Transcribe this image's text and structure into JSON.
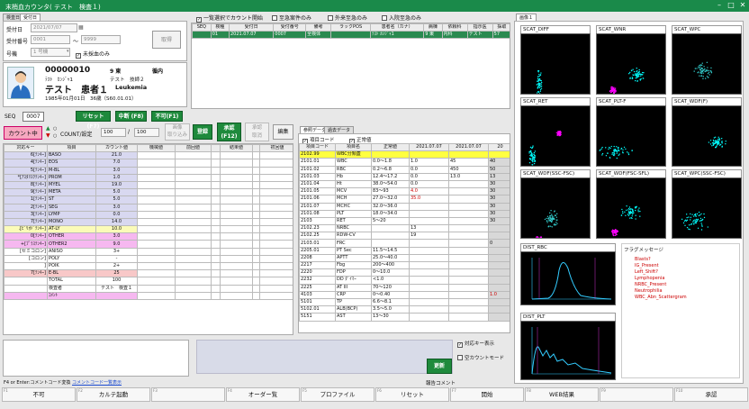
{
  "app": {
    "title": "末梢血カウンタ( テスト　検査１)"
  },
  "tabs_left": [
    "検査日",
    "受付日"
  ],
  "form": {
    "uketsuke_label": "受付日",
    "uketsuke_value": "2021/07/07",
    "bango_label": "受付番号",
    "bango_from": "0001",
    "bango_sep": "～",
    "bango_to": "9999",
    "gouki_label": "号機",
    "gouki_value": "1 号機",
    "mikettei": "未採血のみ",
    "torikomi": "取得"
  },
  "top_checks": [
    "一覧選択でカウント開始",
    "至急案件のみ",
    "外来至急のみ",
    "入院至急のみ"
  ],
  "order_grid": {
    "headers": [
      "SEQ",
      "検種",
      "受付日",
      "受付番号",
      "備考",
      "ラックPOS",
      "患者名（カナ）",
      "病棟",
      "依頼科",
      "指示医",
      "採取"
    ],
    "rows": [
      [
        "",
        "01",
        "2021.07.07",
        "0007",
        "全検体",
        "",
        "ﾃｽﾄ ｶﾝｼﾞｬ1",
        "9 東",
        "内科",
        "テスト",
        "技師２",
        "57"
      ]
    ]
  },
  "patient": {
    "id": "00000010",
    "ward": "9 東",
    "dept": "循内",
    "kana": "ﾃｽﾄ　ｶﾝｼﾞｬ1",
    "doctor": "テスト　技師２",
    "name": "テスト　患者１",
    "disease": "Leukemia",
    "birth": "1985年01月01日　36歳（S60.01.01）"
  },
  "seq": {
    "label": "SEQ",
    "value": "0007"
  },
  "actions": {
    "reset": "リセット(F7)",
    "stop": "中断 (F8)",
    "fuka": "不可(F1)",
    "counting": "カウント中",
    "count_label": "COUNT/設定",
    "count_value": "100",
    "count_set": "100",
    "image_btn": "画像\n取り込み",
    "register": "登録",
    "approve": "承認\n(F12)",
    "cancel_approve": "承認\n取消",
    "edit": "編集"
  },
  "count_table": {
    "headers": [
      "対応キー",
      "項目",
      "カウント値",
      "機械値",
      "前回値",
      "",
      "結果値",
      "",
      "初回値"
    ],
    "rows": [
      {
        "key": "6[ﾃﾝｷｰ]",
        "item": "BASO",
        "count": "21.0",
        "bg": "#d8d8f0"
      },
      {
        "key": "4[ﾃﾝｷｰ]",
        "item": "EOS",
        "count": "7.0",
        "bg": "#d8d8f0"
      },
      {
        "key": "5[ﾃﾝｷｰ]",
        "item": "M-BL",
        "count": "3.0",
        "bg": "#d8d8f0"
      },
      {
        "key": "*[ｱｽﾀﾘｽｸﾃﾝｷｰ]",
        "item": "PROM",
        "count": "1.0",
        "bg": "#d8d8f0"
      },
      {
        "key": "8[ﾃﾝｷｰ]",
        "item": "MYEL",
        "count": "19.0",
        "bg": "#d8d8f0"
      },
      {
        "key": "9[ﾃﾝｷｰ]",
        "item": "META",
        "count": "5.0",
        "bg": "#d8d8f0"
      },
      {
        "key": "1[ﾃﾝｷｰ]",
        "item": "ST",
        "count": "5.0",
        "bg": "#d8d8f0"
      },
      {
        "key": "2[ﾃﾝｷｰ]",
        "item": "SEG",
        "count": "3.0",
        "bg": "#d8d8f0"
      },
      {
        "key": "3[ﾃﾝｷｰ]",
        "item": "LYMP",
        "count": "0.0",
        "bg": "#d8d8f0"
      },
      {
        "key": "7[ﾃﾝｷｰ]",
        "item": "MONO",
        "count": "14.0",
        "bg": "#d8d8f0"
      },
      {
        "key": ".[ﾋﾟﾘｵﾄﾞﾃﾝｷｰ]",
        "item": "AT-LY",
        "count": "10.0",
        "bg": "#fbfbb8"
      },
      {
        "key": "0[ﾃﾝｷｰ]",
        "item": "OTHER",
        "count": "3.0",
        "bg": "#f6b8f0"
      },
      {
        "key": "+[ﾌﾟﾗｽﾃﾝｷｰ]",
        "item": "OTHER2",
        "count": "9.0",
        "bg": "#f6b8f0"
      },
      {
        "key": "[セミコロン]",
        "item": "ANISO",
        "count": "3+",
        "bg": "#fff"
      },
      {
        "key": "[コロン]",
        "item": "POLY",
        "count": "-",
        "bg": "#fff"
      },
      {
        "key": "]",
        "item": "POIK",
        "count": "2+",
        "bg": "#fff"
      },
      {
        "key": "7[ﾃﾝｷｰ]",
        "item": "E-BL",
        "count": "25",
        "bg": "#f8c8c8"
      },
      {
        "key": "",
        "item": "TOTAL",
        "count": "100",
        "bg": "#fff"
      },
      {
        "key": "",
        "item": "検査者",
        "count": "テスト　検査１",
        "bg": "#fff"
      },
      {
        "key": "",
        "item": "ｺﾒﾝﾄ",
        "count": "",
        "bg": "#f6b8f0"
      }
    ]
  },
  "ref": {
    "tabs": [
      "参照データ",
      "過去データ"
    ],
    "chk_code": "項目コード",
    "chk_normal": "正常値",
    "headers": [
      "項目コード",
      "項目名",
      "正常値",
      "2021.07.07",
      "2021.07.07",
      "20"
    ],
    "rows": [
      [
        "2102.99",
        "WBC分類蓋",
        "",
        "",
        "",
        ""
      ],
      [
        "2101.01",
        "WBC",
        "0.0～1.8",
        "1.0",
        "45",
        "40"
      ],
      [
        "2101.02",
        "RBC",
        "0.2～6.8",
        "0.0",
        "450",
        "50"
      ],
      [
        "2101.03",
        "Hb",
        "12.4～17.2",
        "0.0",
        "13.0",
        "13"
      ],
      [
        "2101.04",
        "Ht",
        "38.0～54.0",
        "0.0",
        "",
        "30"
      ],
      [
        "2101.05",
        "MCV",
        "83～93",
        "4.0",
        "",
        "30"
      ],
      [
        "2101.06",
        "MCH",
        "27.0～32.0",
        "35.0",
        "",
        "30"
      ],
      [
        "2101.07",
        "MCHC",
        "32.0～36.0",
        "",
        "",
        "30"
      ],
      [
        "2101.08",
        "PLT",
        "18.0～34.0",
        "",
        "",
        "30"
      ],
      [
        "2103",
        "RET",
        "5～20",
        "",
        "",
        "30"
      ],
      [
        "2102.23",
        "NRBC",
        "",
        "13",
        "",
        ""
      ],
      [
        "2102.25",
        "RDW-CV",
        "",
        "19",
        "",
        ""
      ],
      [
        "2103.01",
        "FRC",
        "",
        "",
        "",
        "0"
      ],
      [
        "2205.01",
        "PT Sec",
        "11.5～14.5",
        "",
        "",
        ""
      ],
      [
        "2208",
        "APTT",
        "25.0～40.0",
        "",
        "",
        ""
      ],
      [
        "2217",
        "Fbg",
        "200～400",
        "",
        "",
        ""
      ],
      [
        "2220",
        "FDP",
        "0～10.0",
        "",
        "",
        ""
      ],
      [
        "2232",
        "DD ﾀﾞｲﾏｰ",
        "<1.0",
        "",
        "",
        ""
      ],
      [
        "2225",
        "AT III",
        "70～120",
        "",
        "",
        ""
      ],
      [
        "4103",
        "CRP",
        "0～0.40",
        "",
        "",
        "1.0"
      ],
      [
        "5101",
        "TP",
        "6.6～8.1",
        "",
        "",
        ""
      ],
      [
        "5102.01",
        "ALB(BCP)",
        "3.5～5.0",
        "",
        "",
        ""
      ],
      [
        "5151",
        "AST",
        "13～30",
        "",
        "",
        ""
      ]
    ]
  },
  "img_tab": "画像１",
  "scatters": [
    "SCAT_DIFF",
    "SCAT_WNR",
    "SCAT_WPC",
    "SCAT_RET",
    "SCAT_PLT-F",
    "SCAT_WDF(F)",
    "SCAT_WDF(SSC-FSC)",
    "SCAT_WDF(FSC-SFL)",
    "SCAT_WPC(SSC-FSC)"
  ],
  "dists": [
    "DIST_RBC",
    "DIST_PLT"
  ],
  "flags": {
    "title": "フラグメッセージ",
    "items": [
      "Blasts?",
      "IG_Present",
      "Left_Shift?",
      "Lymphopenia",
      "NRBC_Present",
      "Neutrophilia",
      "WBC_Abn_Scattergram"
    ]
  },
  "bottom": {
    "hint": "F4 or Enter:コメントコード変換",
    "link": "コメントコード一覧表示",
    "taiou_key": "対応キー表示",
    "kara_count": "空カウントモード",
    "update": "更新",
    "comment_label": "報告コメント"
  },
  "fkeys": [
    {
      "k": "F1",
      "label": "不可"
    },
    {
      "k": "F2",
      "label": "カルテ起動"
    },
    {
      "k": "F3",
      "label": ""
    },
    {
      "k": "F4",
      "label": "オーダー覧"
    },
    {
      "k": "F5",
      "label": "プロファイル"
    },
    {
      "k": "F6",
      "label": "リセット"
    },
    {
      "k": "F7",
      "label": "開始"
    },
    {
      "k": "F8",
      "label": "WEB結果"
    },
    {
      "k": "F9",
      "label": ""
    },
    {
      "k": "F10",
      "label": "承認"
    }
  ]
}
